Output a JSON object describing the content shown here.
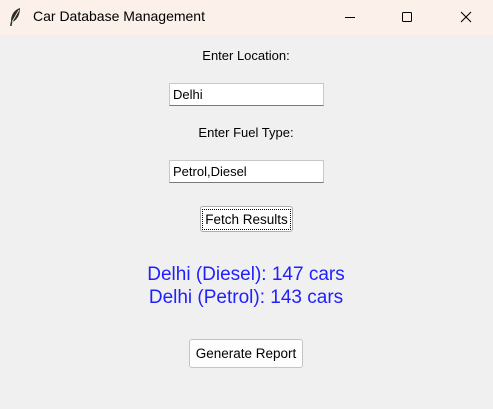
{
  "window": {
    "title": "Car Database Management",
    "icon": "feather-icon",
    "controls": [
      "minimize-icon",
      "maximize-icon",
      "close-icon"
    ]
  },
  "form": {
    "location_label": "Enter Location:",
    "location_value": "Delhi",
    "fuel_label": "Enter Fuel Type:",
    "fuel_value": "Petrol,Diesel"
  },
  "buttons": {
    "fetch_label": "Fetch Results",
    "report_label": "Generate Report"
  },
  "results": {
    "color": "#1f1fff",
    "lines": [
      "Delhi (Diesel): 147 cars",
      "Delhi (Petrol): 143 cars"
    ]
  }
}
